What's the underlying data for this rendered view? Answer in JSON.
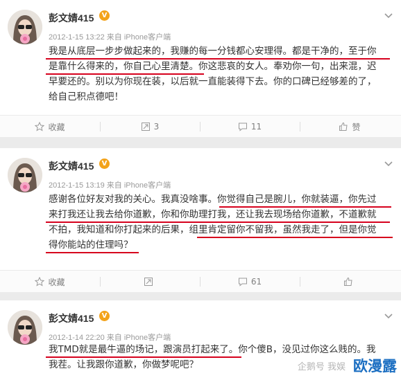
{
  "posts": [
    {
      "user": "彭文婧415",
      "verified": "V",
      "meta": "2012-1-15 13:22 来自 iPhone客户端",
      "lines": [
        "我是从底层一步步做起来的，我赚的每一分钱都心安理得。都是干净的，至于你",
        "是靠什么得来的，你自己心里清楚。你这悲哀的女人。奉劝你一句，出来混，迟",
        "早要还的。别以为你现在装，以后就一直能装得下去。你的口碑已经够差的了，",
        "给自己积点德吧！"
      ],
      "actions": {
        "favorite": "收藏",
        "repost": "3",
        "comment": "11",
        "like": "赞"
      }
    },
    {
      "user": "彭文婧415",
      "verified": "V",
      "meta": "2012-1-15 13:19 来自 iPhone客户端",
      "lines": [
        "感谢各位好友对我的关心。我真没啥事。你觉得自己是腕儿，你就装逼，你先过",
        "来打我还让我去给你道歉，你和你助理打我，还让我去现场给你道歉，不道歉就",
        "不拍，我知道和你打起来的后果，组里肯定留你不留我，虽然我走了，但是你觉",
        "得你能站的住理吗？"
      ],
      "actions": {
        "favorite": "收藏",
        "repost": "",
        "comment": "61",
        "like": ""
      }
    },
    {
      "user": "彭文婧415",
      "verified": "V",
      "meta": "2012-1-14 22:20 来自 iPhone客户端",
      "lines": [
        "我TMD就是最牛逼的场记，跟演员打起来了。你个傻B，没见过你这么贱的。我",
        "我茬。让我跟你道歉，你做梦呢吧？"
      ]
    }
  ],
  "watermark": {
    "main": "欧漫露",
    "small": "企鹅号 我娱"
  },
  "colors": {
    "underline": "#d6001c",
    "badge": "#f3a31b",
    "watermark": "#1c6fc2"
  }
}
